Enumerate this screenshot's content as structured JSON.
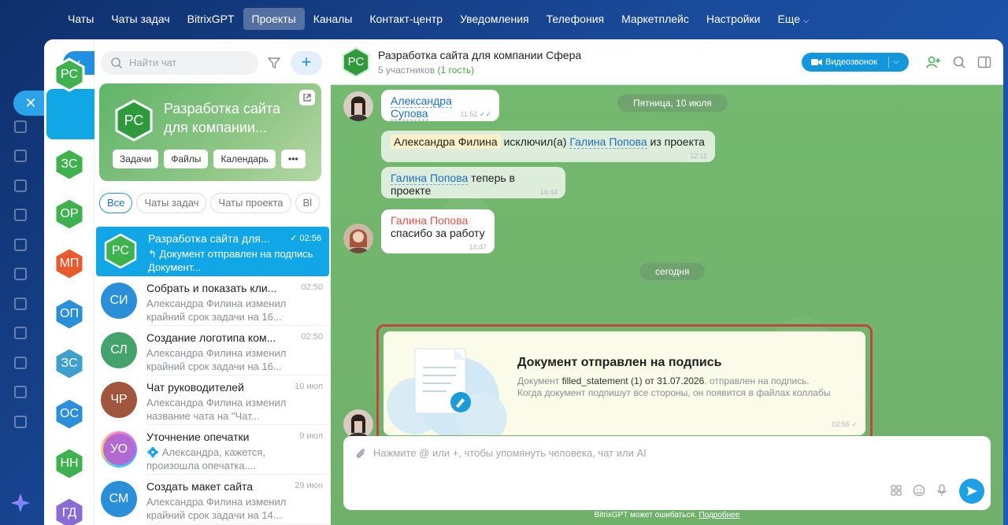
{
  "topnav": [
    "Чаты",
    "Чаты задач",
    "BitrixGPT",
    "Проекты",
    "Каналы",
    "Контакт-центр",
    "Уведомления",
    "Телефония",
    "Маркетплейс",
    "Настройки",
    "Еще"
  ],
  "strip": [
    {
      "initials": "РС",
      "color": "#3fb24f"
    },
    {
      "initials": "ЗС",
      "color": "#3fb24f"
    },
    {
      "initials": "ОР",
      "color": "#3fb24f"
    },
    {
      "initials": "МП",
      "color": "#e85a2e"
    },
    {
      "initials": "ОП",
      "color": "#2a8ed8"
    },
    {
      "initials": "ЗС",
      "color": "#3fa0cf"
    },
    {
      "initials": "ОС",
      "color": "#2a8ed8"
    },
    {
      "initials": "НН",
      "color": "#3fb24f"
    },
    {
      "initials": "ГД",
      "color": "#8a6bd6"
    }
  ],
  "search": {
    "placeholder": "Найти чат"
  },
  "card": {
    "initials": "РС",
    "title": "Разработка сайта для компании...",
    "buttons": [
      "Задачи",
      "Файлы",
      "Календарь",
      "•••"
    ]
  },
  "tabs": [
    "Все",
    "Чаты задач",
    "Чаты проекта",
    "Вl"
  ],
  "chats": [
    {
      "initials": "РС",
      "color": "#3fb24f",
      "title": "Разработка сайта для...",
      "time": "✓ 02:56",
      "preview": "↰ Документ отправлен на подпись Документ..."
    },
    {
      "initials": "СИ",
      "color": "#2a8ed8",
      "title": "Собрать и показать кли...",
      "time": "02:50",
      "preview": "Александра Филина изменил крайний срок задачи на 16..."
    },
    {
      "initials": "СЛ",
      "color": "#43a36a",
      "title": "Создание логотипа ком...",
      "time": "02:50",
      "preview": "Александра Филина изменил крайний срок задачи на 16..."
    },
    {
      "initials": "ЧР",
      "color": "#a0563c",
      "title": "Чат руководителей",
      "time": "10 июл",
      "preview": "Александра Филина изменил название чата на \"Чат..."
    },
    {
      "initials": "УО",
      "color": "#b36ad0",
      "title": "Уточнение опечатки",
      "time": "9 июл",
      "preview": "💠 Александра, кажется, произошла опечатка...."
    },
    {
      "initials": "СМ",
      "color": "#2a8ed8",
      "title": "Создать макет сайта",
      "time": "29 июн",
      "preview": "Александра Филина изменил крайний срок задачи на 14..."
    }
  ],
  "conv": {
    "initials": "РС",
    "title": "Разработка сайта для компании Сфера",
    "members": "5 участников",
    "guest": "(1 гость)",
    "video_label": "Видеозвонок"
  },
  "messages": {
    "date1": "Пятница, 10 июля",
    "m1_name": "Александра Супова",
    "m1_time": "11:52",
    "sys1_actor": "Александра Филина",
    "sys1_action": "исключил(а)",
    "sys1_target": "Галина Попова",
    "sys1_tail": "из проекта",
    "sys1_time": "12:11",
    "sys2_name": "Галина Попова",
    "sys2_tail": "теперь в проекте",
    "sys2_time": "14:44",
    "m2_author": "Галина Попова",
    "m2_text": "спасибо за работу",
    "m2_time": "14:47",
    "date2": "сегодня",
    "doc_title": "Документ отправлен на подпись",
    "doc_pre": "Документ",
    "doc_file": "filled_statement (1) от 31.07.2026",
    "doc_post": ". отправлен на подпись.",
    "doc_line2": "Когда документ подпишут все стороны, он появится в файлах коллабы",
    "doc_time": "02:56 ✓"
  },
  "input": {
    "placeholder": "Нажмите @ или +, чтобы упомянуть человека, чат или AI"
  },
  "footer": {
    "note": "BitrixGPT может ошибаться.",
    "more": "Подробнее"
  }
}
